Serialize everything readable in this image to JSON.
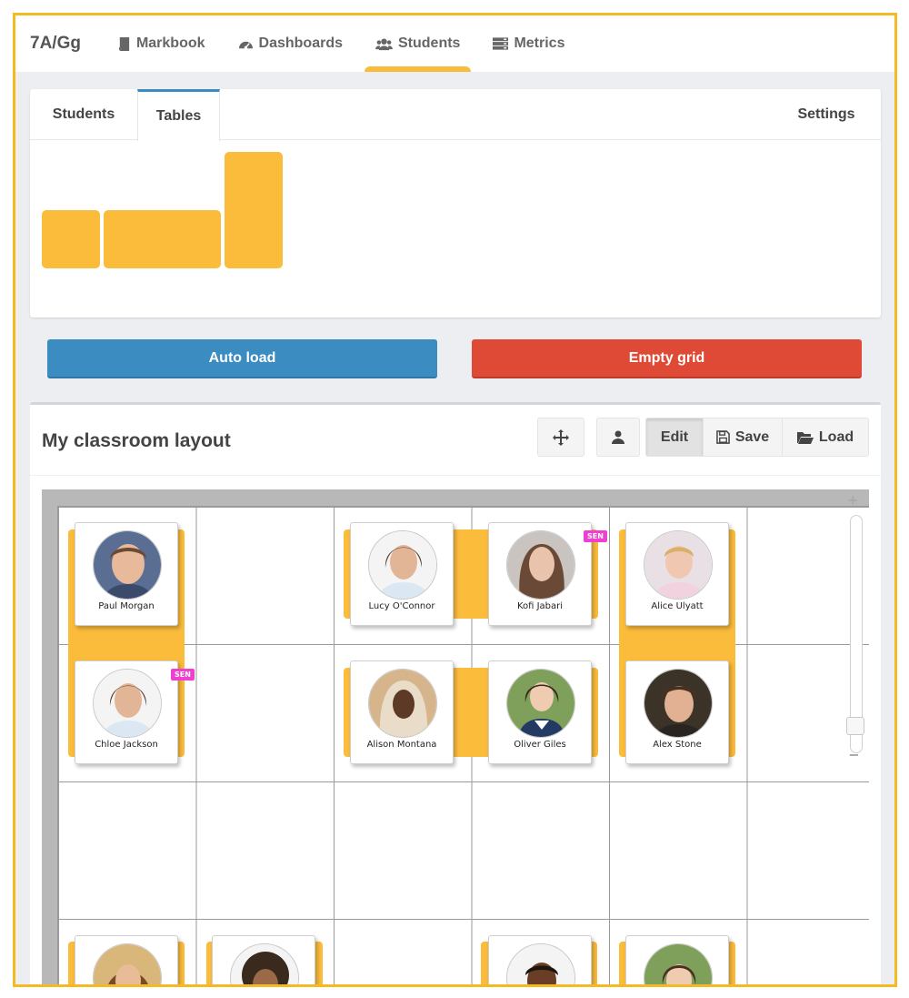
{
  "nav": {
    "brand": "7A/Gg",
    "items": [
      {
        "label": "Markbook",
        "icon": "book-icon"
      },
      {
        "label": "Dashboards",
        "icon": "dashboard-icon"
      },
      {
        "label": "Students",
        "icon": "users-icon",
        "active": true
      },
      {
        "label": "Metrics",
        "icon": "server-icon"
      }
    ]
  },
  "tabs": {
    "students": "Students",
    "tables": "Tables",
    "settings": "Settings",
    "active": "Tables"
  },
  "actions": {
    "auto_load": "Auto load",
    "empty_grid": "Empty grid"
  },
  "layout": {
    "title": "My classroom layout",
    "toolbar": {
      "move_icon": "move-icon",
      "person_icon": "user-icon",
      "edit": "Edit",
      "save": "Save",
      "load": "Load"
    }
  },
  "badges": {
    "sen": "SEN"
  },
  "students": [
    {
      "name": "Paul Morgan",
      "sen": false
    },
    {
      "name": "Lucy O'Connor",
      "sen": false
    },
    {
      "name": "Kofi Jabari",
      "sen": true
    },
    {
      "name": "Alice Ulyatt",
      "sen": false
    },
    {
      "name": "Chloe Jackson",
      "sen": true
    },
    {
      "name": "Alison Montana",
      "sen": false
    },
    {
      "name": "Oliver Giles",
      "sen": false
    },
    {
      "name": "Alex Stone",
      "sen": false
    }
  ],
  "colors": {
    "accent": "#f9bb3b",
    "primary": "#3b8cc0",
    "danger": "#de4a36",
    "sen": "#ee3fd0"
  }
}
